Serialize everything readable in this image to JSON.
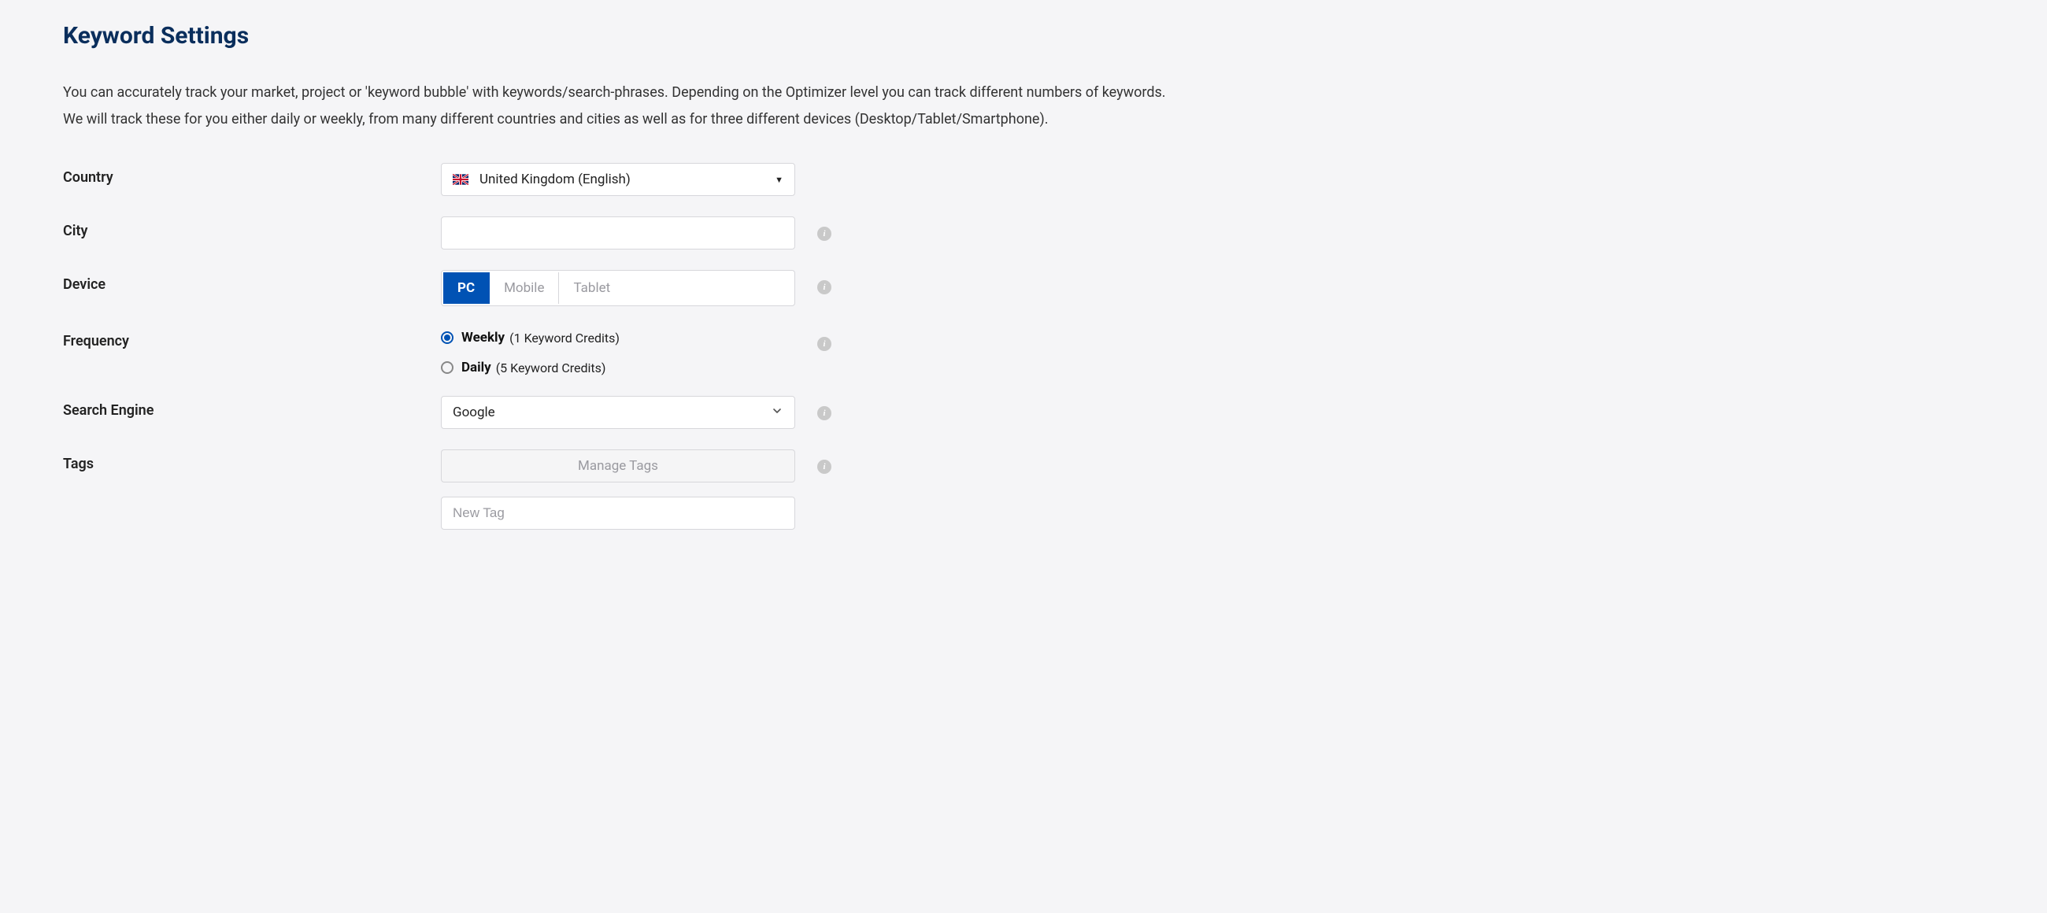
{
  "title": "Keyword Settings",
  "description": "You can accurately track your market, project or 'keyword bubble' with keywords/search-phrases. Depending on the Optimizer level you can track different numbers of keywords. We will track these for you either daily or weekly, from many different countries and cities as well as for three different devices (Desktop/Tablet/Smartphone).",
  "labels": {
    "country": "Country",
    "city": "City",
    "device": "Device",
    "frequency": "Frequency",
    "search_engine": "Search Engine",
    "tags": "Tags"
  },
  "country": {
    "selected": "United Kingdom (English)"
  },
  "city": {
    "value": ""
  },
  "device": {
    "options": [
      "PC",
      "Mobile",
      "Tablet"
    ],
    "selected": "PC"
  },
  "frequency": {
    "options": [
      {
        "name": "Weekly",
        "credits": "(1 Keyword Credits)",
        "selected": true
      },
      {
        "name": "Daily",
        "credits": "(5 Keyword Credits)",
        "selected": false
      }
    ]
  },
  "search_engine": {
    "selected": "Google"
  },
  "tags": {
    "manage_label": "Manage Tags",
    "new_placeholder": "New Tag"
  }
}
